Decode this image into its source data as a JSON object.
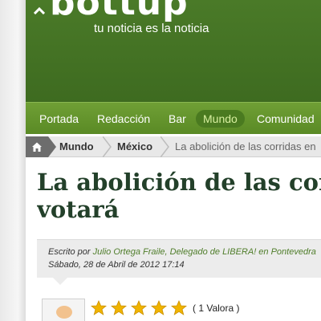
{
  "header": {
    "logo_text": "bottup",
    "tagline": "tu noticia es la noticia",
    "color": "#3e6b20"
  },
  "nav": {
    "items": [
      {
        "label": "Portada"
      },
      {
        "label": "Redacción"
      },
      {
        "label": "Bar"
      },
      {
        "label": "Mundo",
        "active": true
      },
      {
        "label": "Comunidad"
      }
    ]
  },
  "breadcrumb": {
    "home_icon": "home-icon",
    "items": [
      {
        "label": "Mundo"
      },
      {
        "label": "México"
      },
      {
        "label": "La abolición de las corridas en"
      }
    ]
  },
  "article": {
    "title_line1": "La abolición de las corr",
    "title_line2": "votará",
    "meta": {
      "prefix": "Escrito por",
      "author": "Julio Ortega Fraile, Delegado de LIBERA! en Pontevedra",
      "date": "Sábado, 28 de Abril de 2012 17:14"
    },
    "rating": {
      "stars": 5,
      "text": "( 1 Valora )",
      "star_color": "#f0b400"
    }
  }
}
